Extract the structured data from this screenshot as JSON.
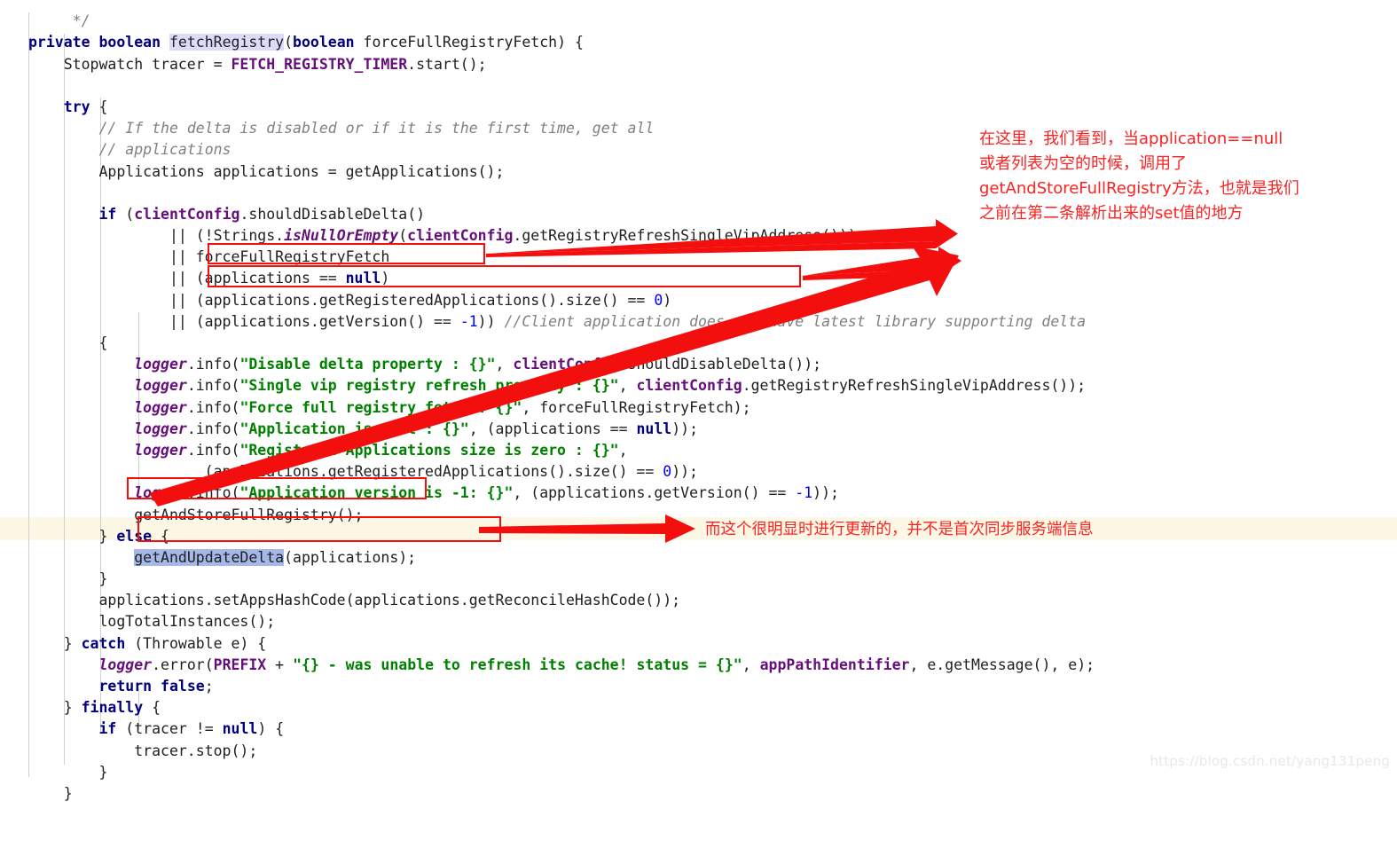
{
  "editor": {
    "language": "java",
    "colors": {
      "background": "#ffffff",
      "keyword": "#000080",
      "string": "#008000",
      "number": "#0000ff",
      "comment": "#808080",
      "field": "#660e7a",
      "selection": "#a6b8e8",
      "identifier_highlight": "#dcdcfa",
      "caret_line": "#fdf8e6",
      "annotation_red": "#f40f0f",
      "annotation_text_red": "#fb2222",
      "indent_guide": "#d0d0d0"
    },
    "caret_line_number": 25,
    "selected_token": "getAndUpdateDelta",
    "highlighted_token": "fetchRegistry"
  },
  "code": {
    "lines": [
      "     */",
      "private boolean fetchRegistry(boolean forceFullRegistryFetch) {",
      "    Stopwatch tracer = FETCH_REGISTRY_TIMER.start();",
      "",
      "    try {",
      "        // If the delta is disabled or if it is the first time, get all",
      "        // applications",
      "        Applications applications = getApplications();",
      "",
      "        if (clientConfig.shouldDisableDelta()",
      "                || (!Strings.isNullOrEmpty(clientConfig.getRegistryRefreshSingleVipAddress()))",
      "                || forceFullRegistryFetch",
      "                || (applications == null)",
      "                || (applications.getRegisteredApplications().size() == 0)",
      "                || (applications.getVersion() == -1)) //Client application does not have latest library supporting delta",
      "        {",
      "            logger.info(\"Disable delta property : {}\", clientConfig.shouldDisableDelta());",
      "            logger.info(\"Single vip registry refresh property : {}\", clientConfig.getRegistryRefreshSingleVipAddress());",
      "            logger.info(\"Force full registry fetch : {}\", forceFullRegistryFetch);",
      "            logger.info(\"Application is null : {}\", (applications == null));",
      "            logger.info(\"Registered Applications size is zero : {}\",",
      "                    (applications.getRegisteredApplications().size() == 0));",
      "            logger.info(\"Application version is -1: {}\", (applications.getVersion() == -1));",
      "            getAndStoreFullRegistry();",
      "        } else {",
      "            getAndUpdateDelta(applications);",
      "        }",
      "        applications.setAppsHashCode(applications.getReconcileHashCode());",
      "        logTotalInstances();",
      "    } catch (Throwable e) {",
      "        logger.error(PREFIX + \"{} - was unable to refresh its cache! status = {}\", appPathIdentifier, e.getMessage(), e);",
      "        return false;",
      "    } finally {",
      "        if (tracer != null) {",
      "            tracer.stop();",
      "        }",
      "    }"
    ]
  },
  "annotations": {
    "note_1": {
      "lines": [
        "在这里，我们看到，当application==null",
        "或者列表为空的时候，调用了",
        "getAndStoreFullRegistry方法，也就是我们",
        "之前在第二条解析出来的set值的地方"
      ]
    },
    "note_2": {
      "text": "而这个很明显时进行更新的，并不是首次同步服务端信息"
    },
    "boxes": [
      {
        "target": "(applications == null)"
      },
      {
        "target": "(applications.getRegisteredApplications().size() == 0)"
      },
      {
        "target": "getAndStoreFullRegistry();"
      },
      {
        "target": "getAndUpdateDelta(applications);"
      }
    ]
  },
  "watermark": {
    "text": "https://blog.csdn.net/yang131peng"
  }
}
